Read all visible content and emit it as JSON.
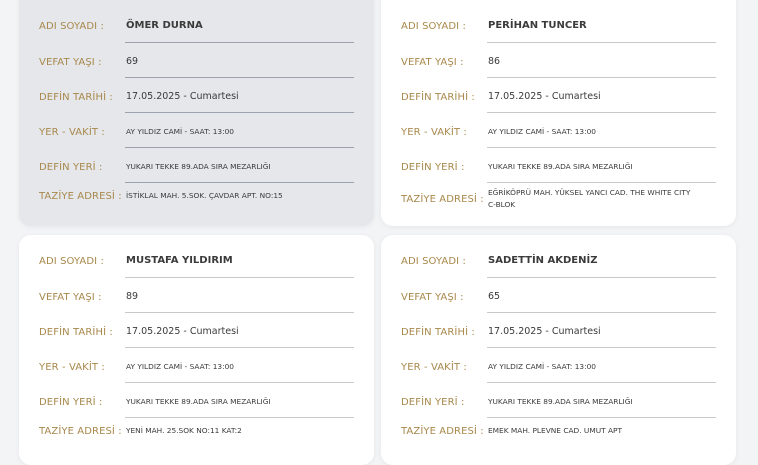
{
  "labels": {
    "name": "ADI SOYADI :",
    "age": "VEFAT YAŞI :",
    "burial_date": "DEFİN TARİHİ :",
    "place_time": "YER - VAKİT :",
    "burial_place": "DEFİN YERİ :",
    "condolence_address": "TAZİYE ADRESİ :"
  },
  "records": [
    {
      "name": "ÖMER DURNA",
      "age": "69",
      "burial_date": "17.05.2025 - Cumartesi",
      "place_time": "AY YILDIZ CAMİ - SAAT: 13:00",
      "burial_place": "YUKARI TEKKE 89.ADA SIRA MEZARLIĞI",
      "condolence_address": "İSTİKLAL MAH. 5.SOK. ÇAVDAR APT. NO:15",
      "highlighted": true
    },
    {
      "name": "PERİHAN TUNCER",
      "age": "86",
      "burial_date": "17.05.2025 - Cumartesi",
      "place_time": "AY YILDIZ CAMİ - SAAT: 13:00",
      "burial_place": "YUKARI TEKKE 89.ADA SIRA MEZARLIĞI",
      "condolence_address": "EĞRİKÖPRÜ MAH. YÜKSEL YANCI CAD. THE WHITE CITY C-BLOK",
      "highlighted": false
    },
    {
      "name": "MUSTAFA YILDIRIM",
      "age": "89",
      "burial_date": "17.05.2025 - Cumartesi",
      "place_time": "AY YILDIZ CAMİ - SAAT: 13:00",
      "burial_place": "YUKARI TEKKE 89.ADA SIRA MEZARLIĞI",
      "condolence_address": "YENİ MAH. 25.SOK NO:11 KAT:2",
      "highlighted": false
    },
    {
      "name": "SADETTİN AKDENİZ",
      "age": "65",
      "burial_date": "17.05.2025 - Cumartesi",
      "place_time": "AY YILDIZ CAMİ - SAAT: 13:00",
      "burial_place": "YUKARI TEKKE 89.ADA SIRA MEZARLIĞI",
      "condolence_address": "EMEK MAH. PLEVNE CAD. UMUT APT",
      "highlighted": false
    }
  ],
  "colors": {
    "label": "#a8884b",
    "value": "#3a3a3a",
    "card": "#ffffff",
    "card_highlight": "#e5e7eb",
    "background": "#f3f4f6"
  }
}
